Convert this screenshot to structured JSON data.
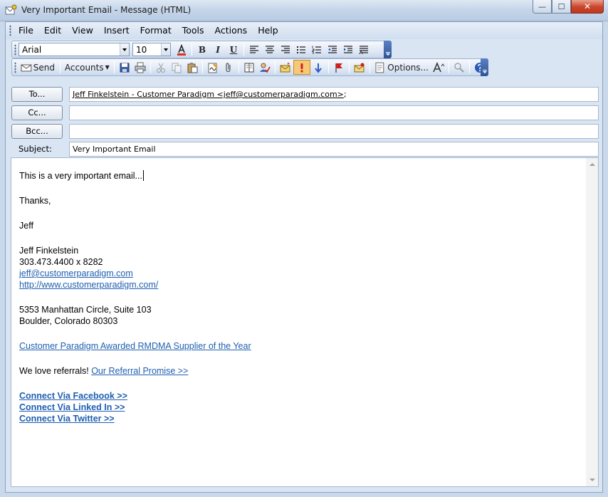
{
  "window": {
    "title": "Very Important Email - Message (HTML)",
    "buttons": {
      "minimize": "—",
      "maximize": "☐",
      "close": "✕"
    }
  },
  "menu": [
    "File",
    "Edit",
    "View",
    "Insert",
    "Format",
    "Tools",
    "Actions",
    "Help"
  ],
  "format_toolbar": {
    "font": "Arial",
    "size": "10",
    "buttons": {
      "bold": "B",
      "italic": "I",
      "underline": "U"
    }
  },
  "standard_toolbar": {
    "send_label": "Send",
    "accounts_label": "Accounts",
    "options_label": "Options..."
  },
  "header": {
    "to_label": "To...",
    "cc_label": "Cc...",
    "bcc_label": "Bcc...",
    "subject_label": "Subject:",
    "to_name": "Jeff Finkelstein - Customer Paradigm <jeff@customerparadigm.com>",
    "to_suffix": ";",
    "cc_value": "",
    "bcc_value": "",
    "subject_value": "Very Important Email"
  },
  "body": {
    "line1": "This is a very important email...",
    "thanks": "Thanks,",
    "sign": "Jeff",
    "sig_name": "Jeff Finkelstein",
    "sig_phone": "303.473.4400 x 8282",
    "sig_email": "jeff@customerparadigm.com",
    "sig_url": "http://www.customerparadigm.com/",
    "addr1": "5353 Manhattan Circle, Suite 103",
    "addr2": "Boulder, Colorado 80303",
    "award_link": "Customer Paradigm Awarded RMDMA Supplier of the Year",
    "referral_text": "We love referrals! ",
    "referral_link": "Our Referral Promise >>",
    "facebook": "Connect Via Facebook >>",
    "linkedin": "Connect Via Linked In >>",
    "twitter": "Connect Via Twitter >>"
  },
  "colors": {
    "link": "#1f5fb0",
    "close_button": "#c9442a",
    "toolbar_end": "#2f5598"
  },
  "icons": [
    "mail-icon",
    "save-icon",
    "print-icon",
    "cut-icon",
    "copy-icon",
    "paste-icon",
    "signature-icon",
    "attach-icon",
    "address-book-icon",
    "check-names-icon",
    "flag-envelope-icon",
    "high-importance-icon",
    "low-importance-icon",
    "follow-up-flag-icon",
    "permission-icon",
    "options-icon",
    "font-size-icon",
    "research-icon",
    "help-icon"
  ]
}
